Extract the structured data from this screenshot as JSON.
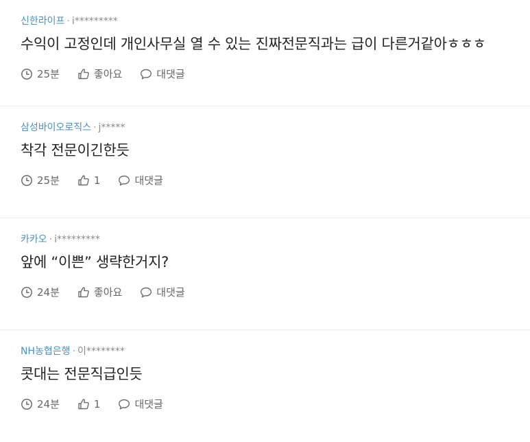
{
  "colors": {
    "company": "#4a8fc2",
    "meta": "#8a8a8a",
    "text": "#222222",
    "action": "#666666",
    "divider": "#ececec"
  },
  "meta_separator": "·",
  "comments": [
    {
      "company": "신한라이프",
      "author": "i*********",
      "text": "수익이 고정인데 개인사무실 열 수 있는 진짜전문직과는 급이 다른거같아ㅎㅎㅎ",
      "time": "25분",
      "like_label": "좋아요",
      "reply_label": "대댓글",
      "time_icon": "clock-icon",
      "like_icon": "thumbs-up-icon",
      "reply_icon": "speech-bubble-icon"
    },
    {
      "company": "삼성바이오로직스",
      "author": "j*****",
      "text": "착각 전문이긴한듯",
      "time": "25분",
      "like_label": "1",
      "reply_label": "대댓글",
      "time_icon": "clock-icon",
      "like_icon": "thumbs-up-icon",
      "reply_icon": "speech-bubble-icon"
    },
    {
      "company": "카카오",
      "author": "i*********",
      "text": "앞에 “이쁜” 생략한거지?",
      "time": "24분",
      "like_label": "좋아요",
      "reply_label": "대댓글",
      "time_icon": "clock-icon",
      "like_icon": "thumbs-up-icon",
      "reply_icon": "speech-bubble-icon"
    },
    {
      "company": "NH농협은행",
      "author": "이********",
      "text": "콧대는 전문직급인듯",
      "time": "24분",
      "like_label": "1",
      "reply_label": "대댓글",
      "time_icon": "clock-icon",
      "like_icon": "thumbs-up-icon",
      "reply_icon": "speech-bubble-icon"
    }
  ]
}
